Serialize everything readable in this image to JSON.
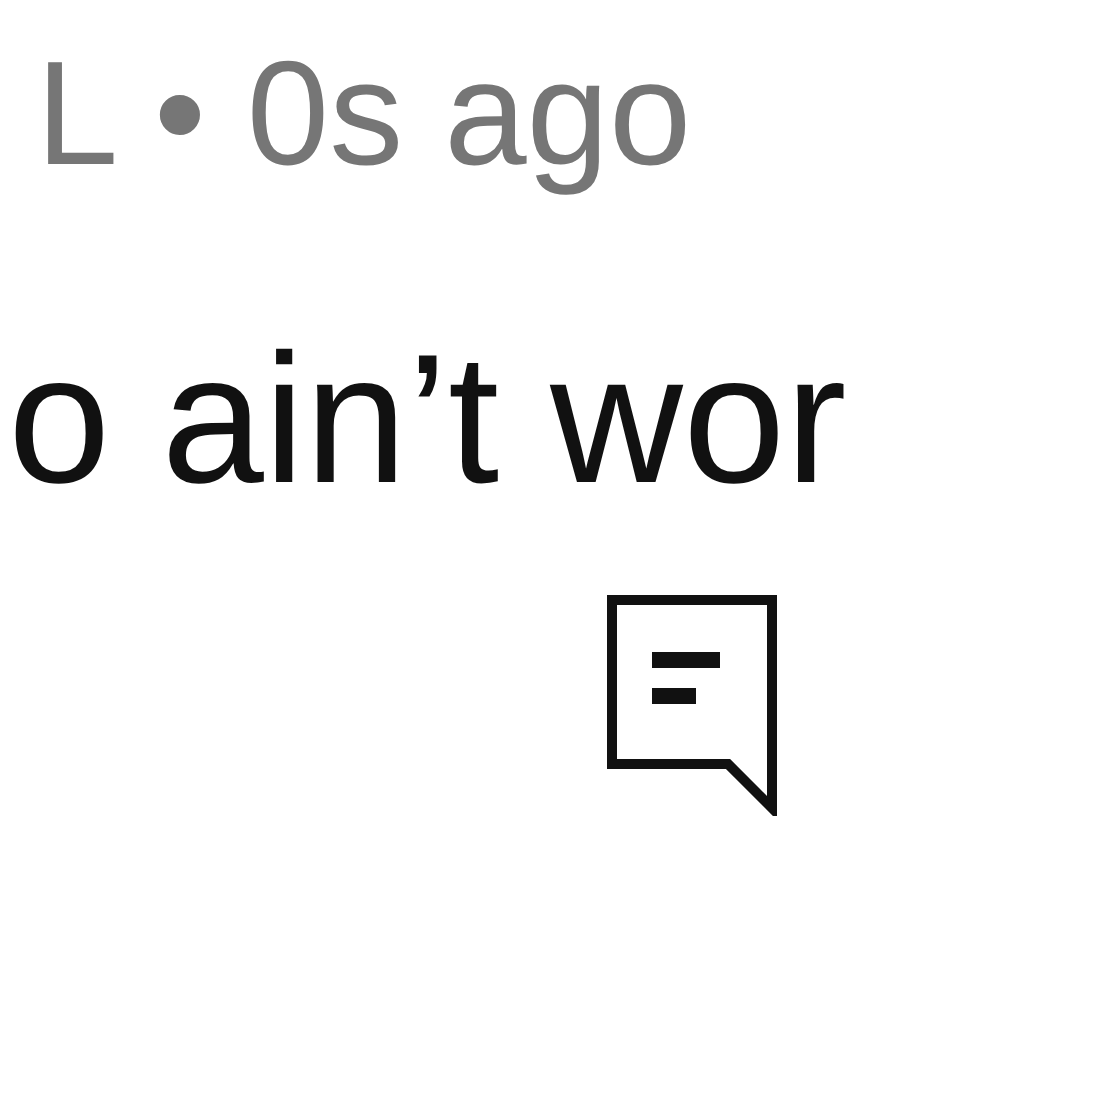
{
  "comment": {
    "meta": "L • 0s ago",
    "text": "o ain’t wor"
  }
}
